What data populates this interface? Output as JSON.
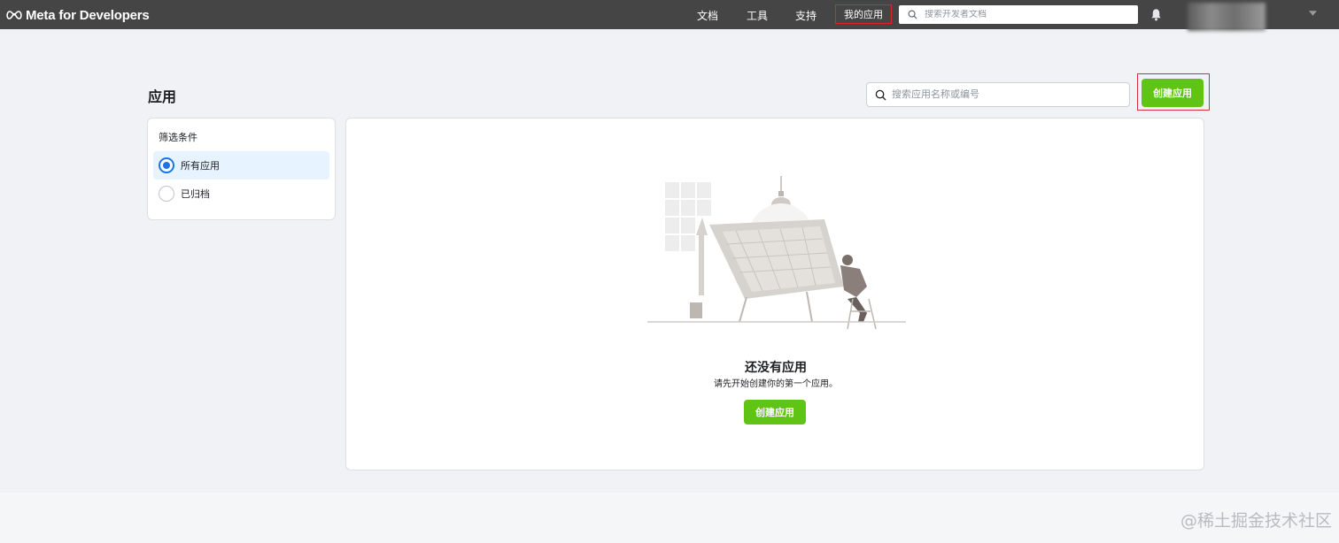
{
  "topbar": {
    "logo_text": "Meta for Developers",
    "nav": [
      "文档",
      "工具",
      "支持"
    ],
    "active_nav": "我的应用",
    "search_placeholder": "搜索开发者文档"
  },
  "page": {
    "title": "应用",
    "search_placeholder": "搜索应用名称或编号",
    "create_button": "创建应用"
  },
  "filters": {
    "title": "筛选条件",
    "options": [
      {
        "label": "所有应用",
        "selected": true
      },
      {
        "label": "已归档",
        "selected": false
      }
    ]
  },
  "empty_state": {
    "title": "还没有应用",
    "subtitle": "请先开始创建你的第一个应用。",
    "button": "创建应用"
  },
  "watermark": "@稀土掘金技术社区",
  "colors": {
    "topbar": "#454545",
    "accent_green": "#5fc413",
    "highlight_red": "#d32f3c",
    "radio_blue": "#1b74e4"
  }
}
